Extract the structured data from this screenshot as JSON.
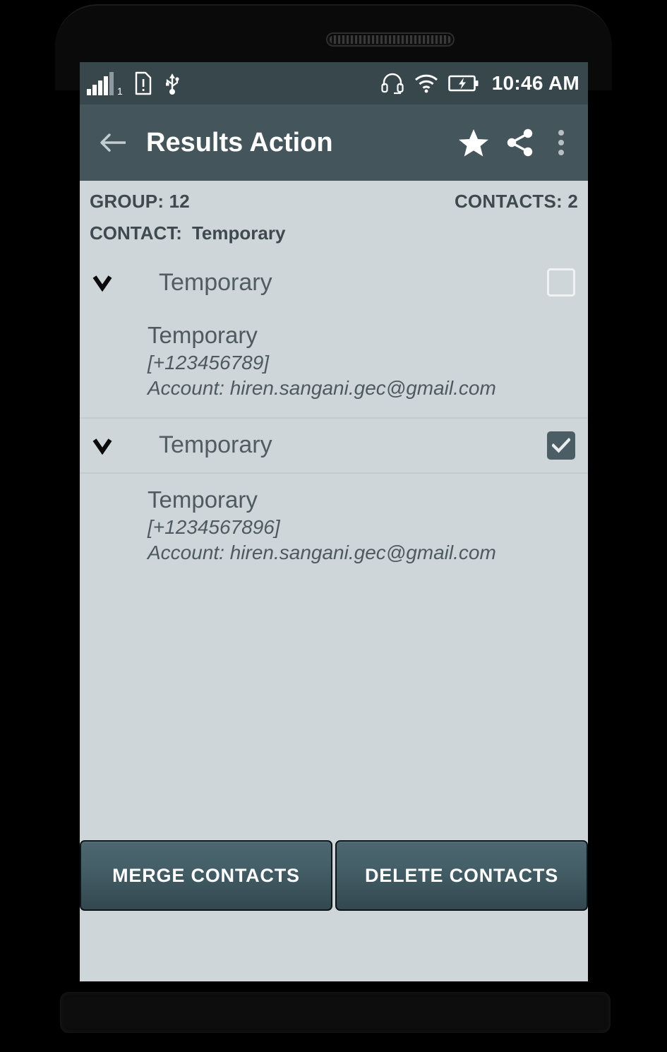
{
  "statusbar": {
    "signal_sim_label": "1",
    "icons": [
      "signal-bars-icon",
      "sim-card-alert-icon",
      "usb-icon",
      "headset-icon",
      "wifi-icon",
      "battery-charging-icon"
    ],
    "time": "10:46 AM"
  },
  "appbar": {
    "back_label": "back-arrow",
    "title": "Results Action",
    "actions": [
      {
        "name": "favorite-star",
        "label": "Favorite"
      },
      {
        "name": "share",
        "label": "Share"
      },
      {
        "name": "overflow-menu",
        "label": "More options"
      }
    ]
  },
  "meta": {
    "group_label": "GROUP: 12",
    "contacts_label": "CONTACTS: 2",
    "contact_prefix": "CONTACT:",
    "contact_value": "Temporary"
  },
  "groups": [
    {
      "name": "Temporary",
      "checked": false,
      "expanded": true,
      "detail": {
        "name": "Temporary",
        "phone": "[+123456789]",
        "account": "Account: hiren.sangani.gec@gmail.com"
      }
    },
    {
      "name": "Temporary",
      "checked": true,
      "expanded": true,
      "detail": {
        "name": "Temporary",
        "phone": "[+1234567896]",
        "account": "Account: hiren.sangani.gec@gmail.com"
      }
    }
  ],
  "buttons": {
    "merge": "MERGE CONTACTS",
    "delete": "DELETE CONTACTS"
  },
  "colors": {
    "statusbar_bg": "#37474c",
    "appbar_bg": "#44565c",
    "content_bg": "#ced6d9",
    "checkbox_checked": "#4c5e65",
    "text_primary": "#3e4a4e",
    "text_secondary": "#4e5a5f",
    "button_gradient_top": "#4d6670",
    "button_gradient_bottom": "#33484f"
  }
}
